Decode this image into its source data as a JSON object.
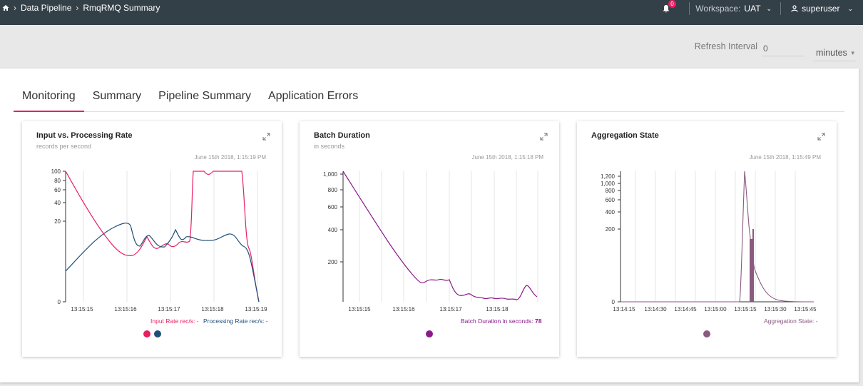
{
  "header": {
    "breadcrumb": [
      "Data Pipeline",
      "RmqRMQ Summary"
    ],
    "notifications_count": "0",
    "workspace_label": "Workspace:",
    "workspace_value": "UAT",
    "user": "superuser"
  },
  "refresh": {
    "label": "Refresh Interval",
    "value": "0",
    "unit": "minutes"
  },
  "tabs": [
    {
      "label": "Monitoring",
      "active": true
    },
    {
      "label": "Summary"
    },
    {
      "label": "Pipeline Summary"
    },
    {
      "label": "Application Errors"
    }
  ],
  "colors": {
    "input": "#e91e63",
    "processing": "#1f4e79",
    "batch": "#8b1a8b",
    "agg": "#8b5a80"
  },
  "charts": [
    {
      "title": "Input vs. Processing Rate",
      "subtitle": "records per second",
      "timestamp": "June 15th 2018, 1:15:19 PM",
      "legend_input": "Input Rate rec/s: -",
      "legend_processing": "Processing Rate rec/s: -"
    },
    {
      "title": "Batch Duration",
      "subtitle": "in seconds",
      "timestamp": "June 15th 2018, 1:15:18 PM",
      "legend_label": "Batch Duration in seconds:",
      "legend_value": "78"
    },
    {
      "title": "Aggregation State",
      "subtitle": "",
      "timestamp": "June 15th 2018, 1:15:49 PM",
      "legend": "Aggregation State: -"
    }
  ],
  "chart_data": [
    {
      "type": "line",
      "title": "Input vs. Processing Rate",
      "x": [
        "13:15:15",
        "13:15:16",
        "13:15:17",
        "13:15:18",
        "13:15:19"
      ],
      "y_ticks": [
        "0",
        "20",
        "40",
        "60",
        "80",
        "100"
      ],
      "series": [
        {
          "name": "Input Rate rec/s",
          "values": [
            100,
            30,
            8,
            11,
            10,
            12,
            100,
            95,
            100,
            100,
            0
          ]
        },
        {
          "name": "Processing Rate rec/s",
          "values": [
            7,
            14,
            20,
            10,
            13,
            10,
            15,
            14,
            16,
            10,
            0
          ]
        }
      ]
    },
    {
      "type": "line",
      "title": "Batch Duration",
      "x": [
        "13:15:15",
        "13:15:16",
        "13:15:17",
        "13:15:18"
      ],
      "y_ticks": [
        "200",
        "400",
        "600",
        "800",
        "1,000"
      ],
      "series": [
        {
          "name": "Batch Duration in seconds",
          "values": [
            1000,
            600,
            300,
            120,
            80,
            78
          ]
        }
      ]
    },
    {
      "type": "line",
      "title": "Aggregation State",
      "x": [
        "13:14:15",
        "13:14:30",
        "13:14:45",
        "13:15:00",
        "13:15:15",
        "13:15:30",
        "13:15:45"
      ],
      "y_ticks": [
        "0",
        "200",
        "400",
        "600",
        "800",
        "1,000",
        "1,200"
      ],
      "series": [
        {
          "name": "Aggregation State",
          "values": [
            0,
            0,
            0,
            0,
            1250,
            200,
            0,
            0
          ]
        }
      ]
    }
  ]
}
